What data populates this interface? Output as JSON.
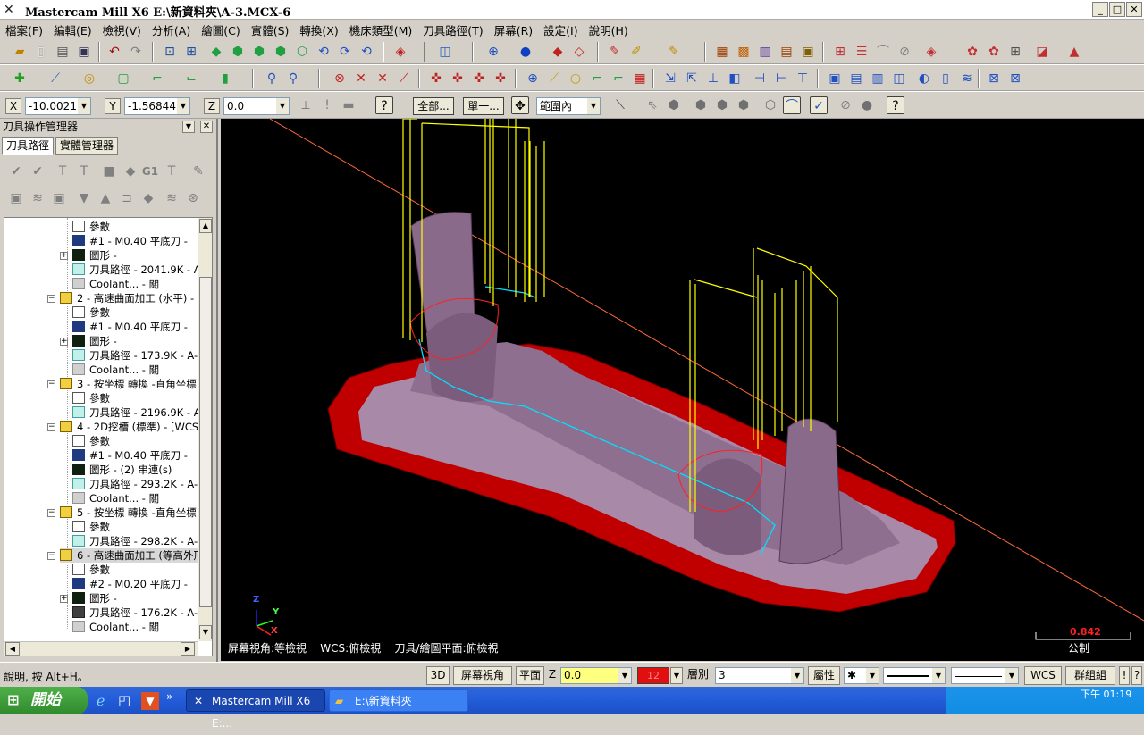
{
  "window": {
    "title": "Mastercam Mill X6  E:\\新資料夾\\A-3.MCX-6",
    "controls": [
      "_",
      "□",
      "✕"
    ]
  },
  "menu": [
    "檔案(F)",
    "編輯(E)",
    "檢視(V)",
    "分析(A)",
    "繪圖(C)",
    "實體(S)",
    "轉換(X)",
    "機床類型(M)",
    "刀具路徑(T)",
    "屏幕(R)",
    "設定(I)",
    "說明(H)"
  ],
  "coords": {
    "x_label": "X",
    "x_value": "-10.00217",
    "y_label": "Y",
    "y_value": "-1.56844",
    "z_label": "Z",
    "z_value": "0.0",
    "btn_all": "全部...",
    "btn_single": "單一...",
    "range_select": "範圍內"
  },
  "panel": {
    "title": "刀具操作管理器",
    "tab_toolpaths": "刀具路徑",
    "tab_solids": "實體管理器",
    "g1_label": "G1",
    "tree": [
      {
        "indent": 76,
        "icon": "folder",
        "text": "參數"
      },
      {
        "indent": 76,
        "icon": "tool",
        "text": "#1 - M0.40 平底刀 -"
      },
      {
        "indent": 76,
        "icon": "geometry",
        "text": "圖形 -",
        "expander": true
      },
      {
        "indent": 76,
        "icon": "path",
        "text": "刀具路徑 - 2041.9K - A-"
      },
      {
        "indent": 76,
        "icon": "coolant",
        "text": "Coolant... - 關"
      },
      {
        "indent": 62,
        "icon": "op",
        "text": "2 - 高速曲面加工 (水平) -",
        "expander": true
      },
      {
        "indent": 76,
        "icon": "folder",
        "text": "參數"
      },
      {
        "indent": 76,
        "icon": "tool",
        "text": "#1 - M0.40 平底刀 -"
      },
      {
        "indent": 76,
        "icon": "geometry",
        "text": "圖形 -",
        "expander": true
      },
      {
        "indent": 76,
        "icon": "path",
        "text": "刀具路徑 - 173.9K - A-"
      },
      {
        "indent": 76,
        "icon": "coolant",
        "text": "Coolant... - 關"
      },
      {
        "indent": 62,
        "icon": "op",
        "text": "3 - 按坐標 轉換 -直角坐標",
        "expander": true
      },
      {
        "indent": 76,
        "icon": "folder",
        "text": "參數"
      },
      {
        "indent": 76,
        "icon": "path",
        "text": "刀具路徑 - 2196.9K - A-"
      },
      {
        "indent": 62,
        "icon": "op",
        "text": "4 - 2D挖槽 (標準) - [WCS:",
        "expander": true
      },
      {
        "indent": 76,
        "icon": "folder",
        "text": "參數"
      },
      {
        "indent": 76,
        "icon": "tool",
        "text": "#1 - M0.40 平底刀 -"
      },
      {
        "indent": 76,
        "icon": "geometry",
        "text": "圖形 - (2) 串連(s)"
      },
      {
        "indent": 76,
        "icon": "path",
        "text": "刀具路徑 - 293.2K - A-"
      },
      {
        "indent": 76,
        "icon": "coolant",
        "text": "Coolant... - 關"
      },
      {
        "indent": 62,
        "icon": "op",
        "text": "5 - 按坐標 轉換 -直角坐標",
        "expander": true
      },
      {
        "indent": 76,
        "icon": "folder",
        "text": "參數"
      },
      {
        "indent": 76,
        "icon": "path",
        "text": "刀具路徑 - 298.2K - A-"
      },
      {
        "indent": 62,
        "icon": "op-active",
        "text": "6 - 高速曲面加工 (等高外形",
        "expander": true,
        "selected": true
      },
      {
        "indent": 76,
        "icon": "folder",
        "text": "參數"
      },
      {
        "indent": 76,
        "icon": "tool",
        "text": "#2 - M0.20 平底刀 -"
      },
      {
        "indent": 76,
        "icon": "geometry",
        "text": "圖形 -",
        "expander": true
      },
      {
        "indent": 76,
        "icon": "path-dark",
        "text": "刀具路徑 - 176.2K - A-"
      },
      {
        "indent": 76,
        "icon": "coolant",
        "text": "Coolant... - 關"
      }
    ]
  },
  "viewport": {
    "info": "屏幕視角:等檢視    WCS:俯檢視    刀具/繪圖平面:俯檢視",
    "scale_value": "0.842",
    "scale_unit": "公制",
    "axis_x": "X",
    "axis_y": "Y",
    "axis_z": "Z",
    "colors": {
      "part": "#8a6a8a",
      "stock": "#c00000",
      "toolpath_yellow": "#ffff00",
      "toolpath_cyan": "#00e0ff"
    }
  },
  "status": {
    "help": "說明, 按 Alt+H。",
    "btn_3d": "3D",
    "btn_gview": "屏幕視角",
    "btn_plane": "平面",
    "z_label": "Z",
    "z_value": "0.0",
    "color_value": "12",
    "level_label": "層別",
    "level_value": "3",
    "attr_label": "屬性",
    "wcs_label": "WCS",
    "group_label": "群組組",
    "help_icon": "!",
    "question": "?",
    "point_style": "✱",
    "nav_left": "◀",
    "nav_right": "▶"
  },
  "taskbar": {
    "start": "開始",
    "task_mastercam": "Mastercam Mill X6  E:...",
    "task_folder": "E:\\新資料夾",
    "clock": "下午 01:19",
    "more": "»"
  }
}
